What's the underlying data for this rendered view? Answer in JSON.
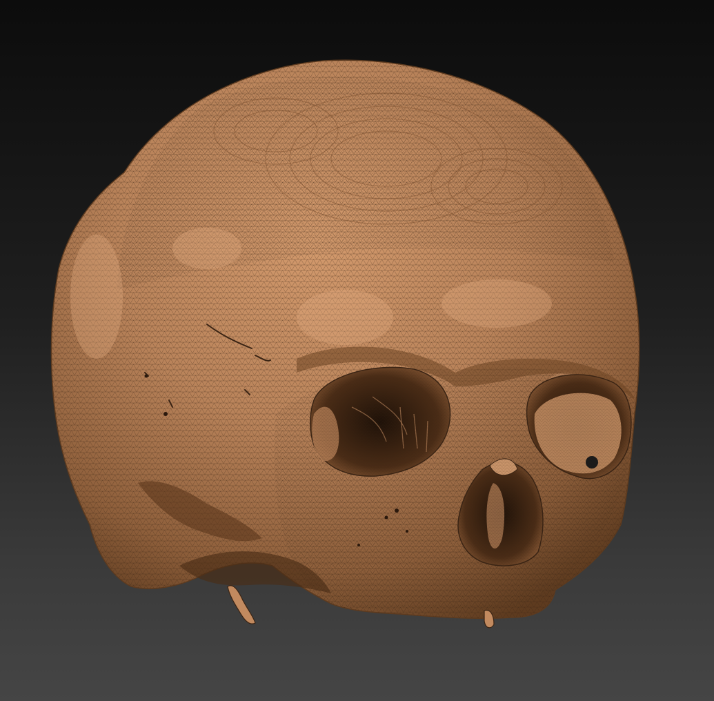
{
  "viewport": {
    "background_top": "#0c0c0c",
    "background_bottom": "#454545"
  },
  "model": {
    "subject": "skull-mesh",
    "render_mode": "wireframe-over-shaded",
    "surface_color": "#b9835a",
    "shadow_color": "#5e3b1f",
    "highlight_color": "#e3ad82",
    "wire_color": "#3a2414",
    "cavity_color": "#2a180c"
  }
}
